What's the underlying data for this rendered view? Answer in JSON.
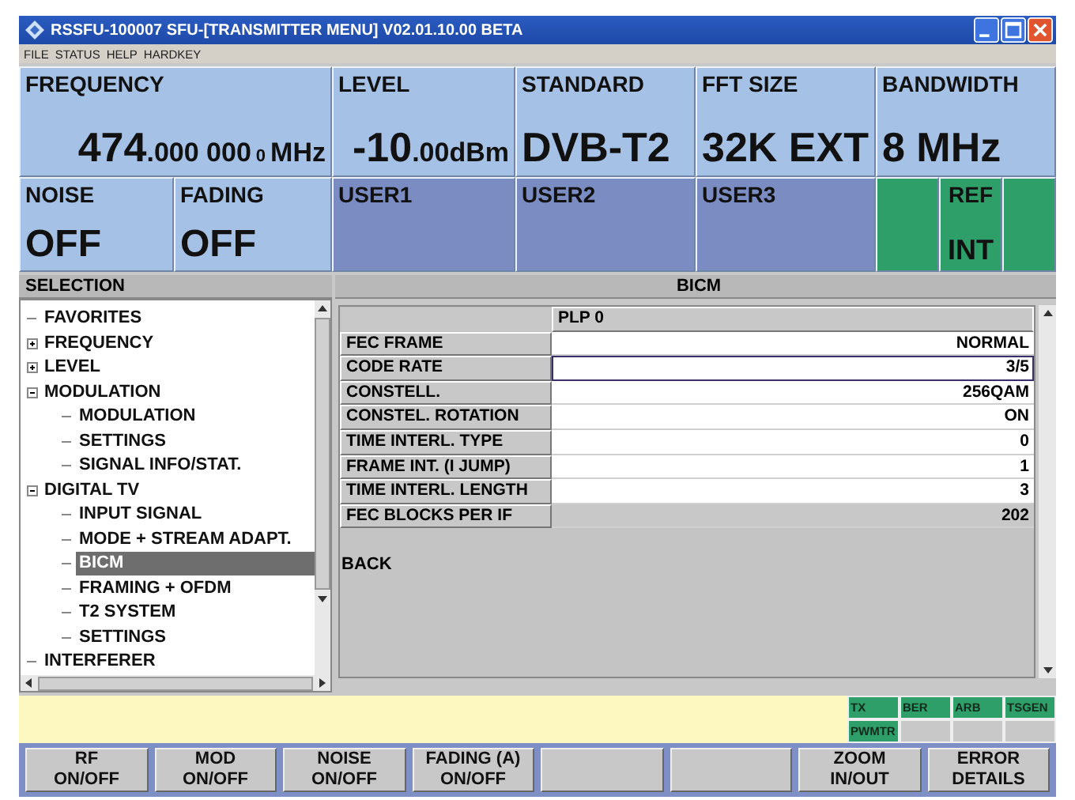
{
  "window": {
    "title": "RSSFU-100007  SFU-[TRANSMITTER MENU]  V02.01.10.00 BETA"
  },
  "menu": [
    "FILE",
    "STATUS",
    "HELP",
    "HARDKEY"
  ],
  "top_row": [
    {
      "label": "FREQUENCY",
      "kind": "readout",
      "value_parts": [
        {
          "text": "474",
          "kind": "large"
        },
        {
          "text": ".000 000",
          "kind": "medium"
        },
        {
          "text": "0",
          "kind": "small"
        },
        {
          "text": "MHz",
          "kind": "medium"
        }
      ]
    },
    {
      "label": "LEVEL",
      "kind": "readout",
      "value_parts": [
        {
          "text": "-10",
          "kind": "large"
        },
        {
          "text": ".00",
          "kind": "medium"
        },
        {
          "text": "dBm",
          "kind": "medium"
        }
      ]
    },
    {
      "label": "STANDARD",
      "kind": "setting",
      "value_parts": [
        {
          "text": "DVB-T2",
          "kind": "large"
        }
      ]
    },
    {
      "label": "FFT SIZE",
      "kind": "setting",
      "value_parts": [
        {
          "text": "32K EXT",
          "kind": "large"
        }
      ]
    },
    {
      "label": "BANDWIDTH",
      "kind": "setting",
      "value_parts": [
        {
          "text": "8 MHz",
          "kind": "large"
        }
      ]
    }
  ],
  "second_row": [
    {
      "kind": "setting",
      "label": "NOISE",
      "value": "OFF"
    },
    {
      "kind": "setting",
      "label": "FADING",
      "value": "OFF"
    },
    {
      "kind": "user",
      "label": "USER1"
    },
    {
      "kind": "user",
      "label": "USER2"
    },
    {
      "kind": "user",
      "label": "USER3"
    },
    {
      "kind": "blank"
    },
    {
      "kind": "reference",
      "label": "REF",
      "value": "INT"
    },
    {
      "kind": "blank"
    }
  ],
  "selection": {
    "title": "SELECTION",
    "items": [
      {
        "label": "FAVORITES",
        "selected": false
      },
      {
        "label": "FREQUENCY",
        "selected": false,
        "expanded": false
      },
      {
        "label": "LEVEL",
        "selected": false,
        "expanded": false
      },
      {
        "label": "MODULATION",
        "selected": false,
        "expanded": true,
        "children": [
          {
            "label": "MODULATION",
            "selected": false
          },
          {
            "label": "SETTINGS",
            "selected": false
          },
          {
            "label": "SIGNAL INFO/STAT.",
            "selected": false
          }
        ]
      },
      {
        "label": "DIGITAL TV",
        "selected": false,
        "expanded": true,
        "children": [
          {
            "label": "INPUT SIGNAL",
            "selected": false
          },
          {
            "label": "MODE + STREAM ADAPT.",
            "selected": false
          },
          {
            "label": "BICM",
            "selected": true
          },
          {
            "label": "FRAMING + OFDM",
            "selected": false
          },
          {
            "label": "T2 SYSTEM",
            "selected": false
          },
          {
            "label": "SETTINGS",
            "selected": false
          }
        ]
      },
      {
        "label": "INTERFERER",
        "selected": false
      }
    ]
  },
  "panel": {
    "title": "BICM",
    "column": "PLP 0",
    "rows": [
      {
        "label": "FEC FRAME",
        "value": "NORMAL",
        "editable": true,
        "focused": false
      },
      {
        "label": "CODE RATE",
        "value": "3/5",
        "editable": true,
        "focused": true
      },
      {
        "label": "CONSTELL.",
        "value": "256QAM",
        "editable": true,
        "focused": false
      },
      {
        "label": "CONSTEL. ROTATION",
        "value": "ON",
        "editable": true,
        "focused": false
      },
      {
        "label": "TIME INTERL. TYPE",
        "value": "0",
        "editable": true,
        "focused": false
      },
      {
        "label": "FRAME INT. (I JUMP)",
        "value": "1",
        "editable": true,
        "focused": false
      },
      {
        "label": "TIME INTERL. LENGTH",
        "value": "3",
        "editable": true,
        "focused": false
      },
      {
        "label": "FEC BLOCKS PER IF",
        "value": "202",
        "editable": false,
        "focused": false
      }
    ],
    "back": "BACK"
  },
  "status_indicators": [
    [
      {
        "label": "TX",
        "on": true
      },
      {
        "label": "BER",
        "on": true
      },
      {
        "label": "ARB",
        "on": true
      },
      {
        "label": "TSGEN",
        "on": true
      }
    ],
    [
      {
        "label": "PWMTR",
        "on": true
      },
      {
        "on": false
      },
      {
        "on": false
      },
      {
        "on": false
      }
    ]
  ],
  "softkeys": [
    {
      "kind": "labelled",
      "lines": [
        "RF",
        "ON/OFF"
      ]
    },
    {
      "kind": "labelled",
      "lines": [
        "MOD",
        "ON/OFF"
      ]
    },
    {
      "kind": "labelled",
      "lines": [
        "NOISE",
        "ON/OFF"
      ]
    },
    {
      "kind": "labelled",
      "lines": [
        "FADING (A)",
        "ON/OFF"
      ]
    },
    {
      "kind": "blank"
    },
    {
      "kind": "blank"
    },
    {
      "kind": "labelled",
      "lines": [
        "ZOOM",
        "IN/OUT"
      ]
    },
    {
      "kind": "labelled",
      "lines": [
        "ERROR",
        "DETAILS"
      ]
    }
  ]
}
